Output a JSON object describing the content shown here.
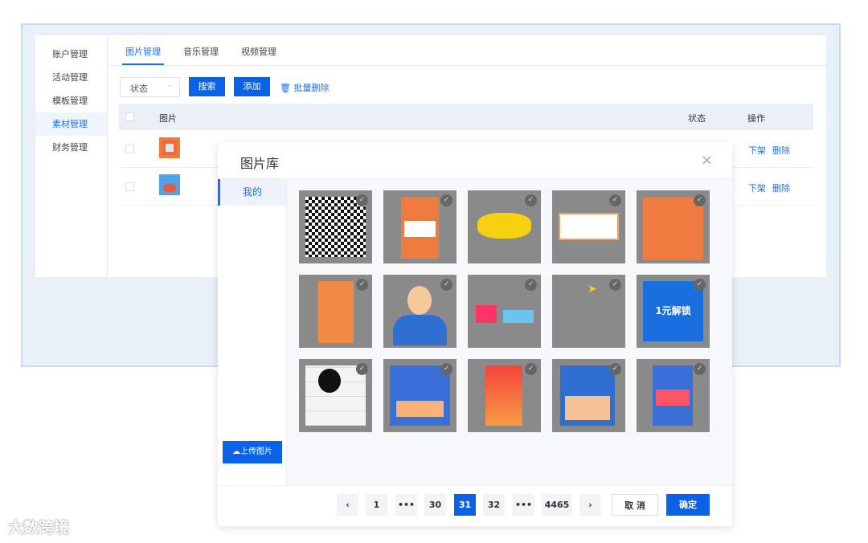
{
  "sidebar": {
    "items": [
      {
        "label": "账户管理"
      },
      {
        "label": "活动管理"
      },
      {
        "label": "模板管理"
      },
      {
        "label": "素材管理",
        "active": true
      },
      {
        "label": "财务管理"
      }
    ]
  },
  "tabs": [
    {
      "label": "图片管理",
      "active": true
    },
    {
      "label": "音乐管理"
    },
    {
      "label": "视频管理"
    }
  ],
  "toolbar": {
    "status_select": "状态",
    "search": "搜索",
    "add": "添加",
    "batch_delete": "批量删除"
  },
  "table": {
    "headers": [
      "图片",
      "状态",
      "操作"
    ],
    "rows": [
      {
        "actions": [
          "下架",
          "删除"
        ]
      },
      {
        "actions": [
          "下架",
          "删除"
        ]
      }
    ]
  },
  "modal": {
    "title": "图片库",
    "close": "×",
    "category": "我的",
    "upload": "上传图片",
    "confirm": "确定",
    "cancel": "取 消",
    "thumb_text": "1元解锁",
    "pagination": {
      "prev": "‹",
      "next": "›",
      "pages": [
        "1",
        "•••",
        "30",
        "31",
        "32",
        "•••",
        "4465"
      ],
      "current": "31"
    }
  },
  "watermark": "大数跨境",
  "colors": {
    "accent": "#0a63e6",
    "frame": "#eaf0f8"
  }
}
